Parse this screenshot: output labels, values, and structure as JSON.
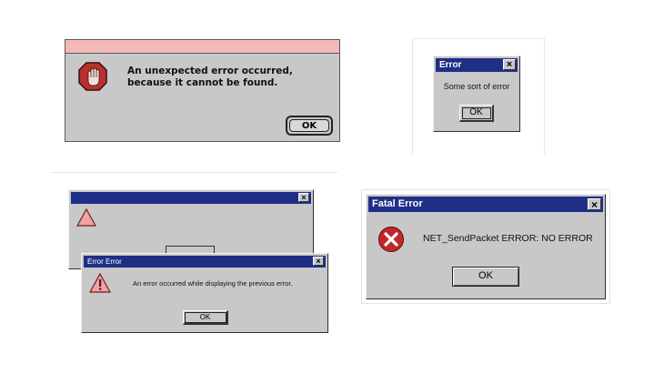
{
  "mac_dialog": {
    "message": "An unexpected error occurred, because it cannot be found.",
    "ok_label": "OK",
    "stripe_color": "#f3b9b9"
  },
  "small_dialog": {
    "title": "Error",
    "close_glyph": "×",
    "message": "Some sort of error",
    "ok_label": "OK"
  },
  "back_dialog": {
    "close_glyph": "×"
  },
  "error_error_dialog": {
    "title": "Error Error",
    "close_glyph": "×",
    "message": "An error occurred while displaying the previous error.",
    "ok_label": "OK"
  },
  "fatal_dialog": {
    "title": "Fatal Error",
    "close_glyph": "×",
    "message": "NET_SendPacket ERROR: NO ERROR",
    "ok_label": "OK"
  },
  "colors": {
    "title_bar": "#1f2f86",
    "window_face": "#c8c8c8",
    "error_icon": "#c0282b",
    "warning_icon": "#f1a2a2"
  }
}
